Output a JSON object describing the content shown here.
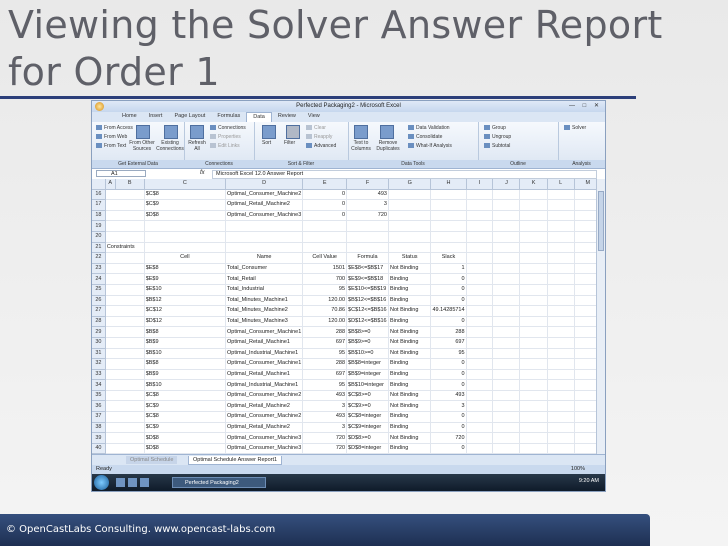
{
  "slide": {
    "title": "Viewing the Solver Answer Report for Order 1",
    "footer": "© OpenCastLabs Consulting. www.opencast-labs.com"
  },
  "excel": {
    "window_title": "Perfected Packaging2 - Microsoft Excel",
    "tabs": [
      "Home",
      "Insert",
      "Page Layout",
      "Formulas",
      "Data",
      "Review",
      "View"
    ],
    "active_tab": "Data",
    "ribbon": {
      "get_external_data": {
        "group": "Get External Data",
        "items": [
          "From Access",
          "From Web",
          "From Text",
          "From Other Sources",
          "Existing Connections"
        ]
      },
      "connections": {
        "group": "Connections",
        "refresh": "Refresh All",
        "items": [
          "Connections",
          "Properties",
          "Edit Links"
        ]
      },
      "sort_filter": {
        "group": "Sort & Filter",
        "items": [
          "Sort",
          "Filter",
          "Clear",
          "Reapply",
          "Advanced"
        ]
      },
      "data_tools": {
        "group": "Data Tools",
        "items": [
          "Text to Columns",
          "Remove Duplicates",
          "Data Validation",
          "Consolidate",
          "What-If Analysis"
        ]
      },
      "outline": {
        "group": "Outline",
        "items": [
          "Group",
          "Ungroup",
          "Subtotal"
        ]
      },
      "analysis": {
        "group": "Analysis",
        "items": [
          "Solver"
        ]
      }
    },
    "name_box": "A1",
    "fx": "fx",
    "formula": "Microsoft Excel 12.0 Answer Report",
    "columns": [
      "A",
      "B",
      "C",
      "D",
      "E",
      "F",
      "G",
      "H",
      "I",
      "J",
      "K",
      "L",
      "M"
    ],
    "rows": [
      {
        "n": "16",
        "b": "$C$8",
        "c": "Optimal_Consumer_Machine2",
        "d": "0",
        "e": "493",
        "f": "",
        "g": ""
      },
      {
        "n": "17",
        "b": "$C$9",
        "c": "Optimal_Retail_Machine2",
        "d": "0",
        "e": "3",
        "f": "",
        "g": ""
      },
      {
        "n": "18",
        "b": "$D$8",
        "c": "Optimal_Consumer_Machine3",
        "d": "0",
        "e": "720",
        "f": "",
        "g": ""
      },
      {
        "n": "19",
        "b": "",
        "c": "",
        "d": "",
        "e": "",
        "f": "",
        "g": ""
      },
      {
        "n": "20",
        "b": "",
        "c": "",
        "d": "",
        "e": "",
        "f": "",
        "g": ""
      },
      {
        "n": "21",
        "a": "Constraints",
        "b": "",
        "c": "",
        "d": "",
        "e": "",
        "f": "",
        "g": ""
      },
      {
        "n": "22",
        "b": "Cell",
        "c": "Name",
        "d": "Cell Value",
        "e": "Formula",
        "f": "Status",
        "g": "Slack",
        "header": true
      },
      {
        "n": "23",
        "b": "$E$8",
        "c": "Total_Consumer",
        "d": "1501",
        "e": "$E$8<=$B$17",
        "f": "Not Binding",
        "g": "1"
      },
      {
        "n": "24",
        "b": "$E$9",
        "c": "Total_Retail",
        "d": "700",
        "e": "$E$9<=$B$18",
        "f": "Binding",
        "g": "0"
      },
      {
        "n": "25",
        "b": "$E$10",
        "c": "Total_Industrial",
        "d": "95",
        "e": "$E$10<=$B$19",
        "f": "Binding",
        "g": "0"
      },
      {
        "n": "26",
        "b": "$B$12",
        "c": "Total_Minutes_Machine1",
        "d": "120.00",
        "e": "$B$12<=$B$16",
        "f": "Binding",
        "g": "0"
      },
      {
        "n": "27",
        "b": "$C$12",
        "c": "Total_Minutes_Machine2",
        "d": "70.86",
        "e": "$C$12<=$B$16",
        "f": "Not Binding",
        "g": "49.14285714"
      },
      {
        "n": "28",
        "b": "$D$12",
        "c": "Total_Minutes_Machine3",
        "d": "120.00",
        "e": "$D$12<=$B$16",
        "f": "Binding",
        "g": "0"
      },
      {
        "n": "29",
        "b": "$B$8",
        "c": "Optimal_Consumer_Machine1",
        "d": "288",
        "e": "$B$8>=0",
        "f": "Not Binding",
        "g": "288"
      },
      {
        "n": "30",
        "b": "$B$9",
        "c": "Optimal_Retail_Machine1",
        "d": "697",
        "e": "$B$9>=0",
        "f": "Not Binding",
        "g": "697"
      },
      {
        "n": "31",
        "b": "$B$10",
        "c": "Optimal_Industrial_Machine1",
        "d": "95",
        "e": "$B$10>=0",
        "f": "Not Binding",
        "g": "95"
      },
      {
        "n": "32",
        "b": "$B$8",
        "c": "Optimal_Consumer_Machine1",
        "d": "288",
        "e": "$B$8=integer",
        "f": "Binding",
        "g": "0"
      },
      {
        "n": "33",
        "b": "$B$9",
        "c": "Optimal_Retail_Machine1",
        "d": "697",
        "e": "$B$9=integer",
        "f": "Binding",
        "g": "0"
      },
      {
        "n": "34",
        "b": "$B$10",
        "c": "Optimal_Industrial_Machine1",
        "d": "95",
        "e": "$B$10=integer",
        "f": "Binding",
        "g": "0"
      },
      {
        "n": "35",
        "b": "$C$8",
        "c": "Optimal_Consumer_Machine2",
        "d": "493",
        "e": "$C$8>=0",
        "f": "Not Binding",
        "g": "493"
      },
      {
        "n": "36",
        "b": "$C$9",
        "c": "Optimal_Retail_Machine2",
        "d": "3",
        "e": "$C$9>=0",
        "f": "Not Binding",
        "g": "3"
      },
      {
        "n": "37",
        "b": "$C$8",
        "c": "Optimal_Consumer_Machine2",
        "d": "493",
        "e": "$C$8=integer",
        "f": "Binding",
        "g": "0"
      },
      {
        "n": "38",
        "b": "$C$9",
        "c": "Optimal_Retail_Machine2",
        "d": "3",
        "e": "$C$9=integer",
        "f": "Binding",
        "g": "0"
      },
      {
        "n": "39",
        "b": "$D$8",
        "c": "Optimal_Consumer_Machine3",
        "d": "720",
        "e": "$D$8>=0",
        "f": "Not Binding",
        "g": "720"
      },
      {
        "n": "40",
        "b": "$D$8",
        "c": "Optimal_Consumer_Machine3",
        "d": "720",
        "e": "$D$8=integer",
        "f": "Binding",
        "g": "0"
      },
      {
        "n": "41",
        "b": "",
        "c": "",
        "d": "",
        "e": "",
        "f": "",
        "g": ""
      }
    ],
    "sheet_tab_inactive": "Optimal Schedule",
    "sheet_tab_active": "Optimal Schedule Answer Report1",
    "status": "Ready",
    "zoom": "100%",
    "taskbar_item": "Perfected Packaging2",
    "clock": "9:20 AM"
  },
  "colors": {
    "title": "#5f6068",
    "rule": "#2c3f7a",
    "footer_bg": "#1e2f52"
  }
}
